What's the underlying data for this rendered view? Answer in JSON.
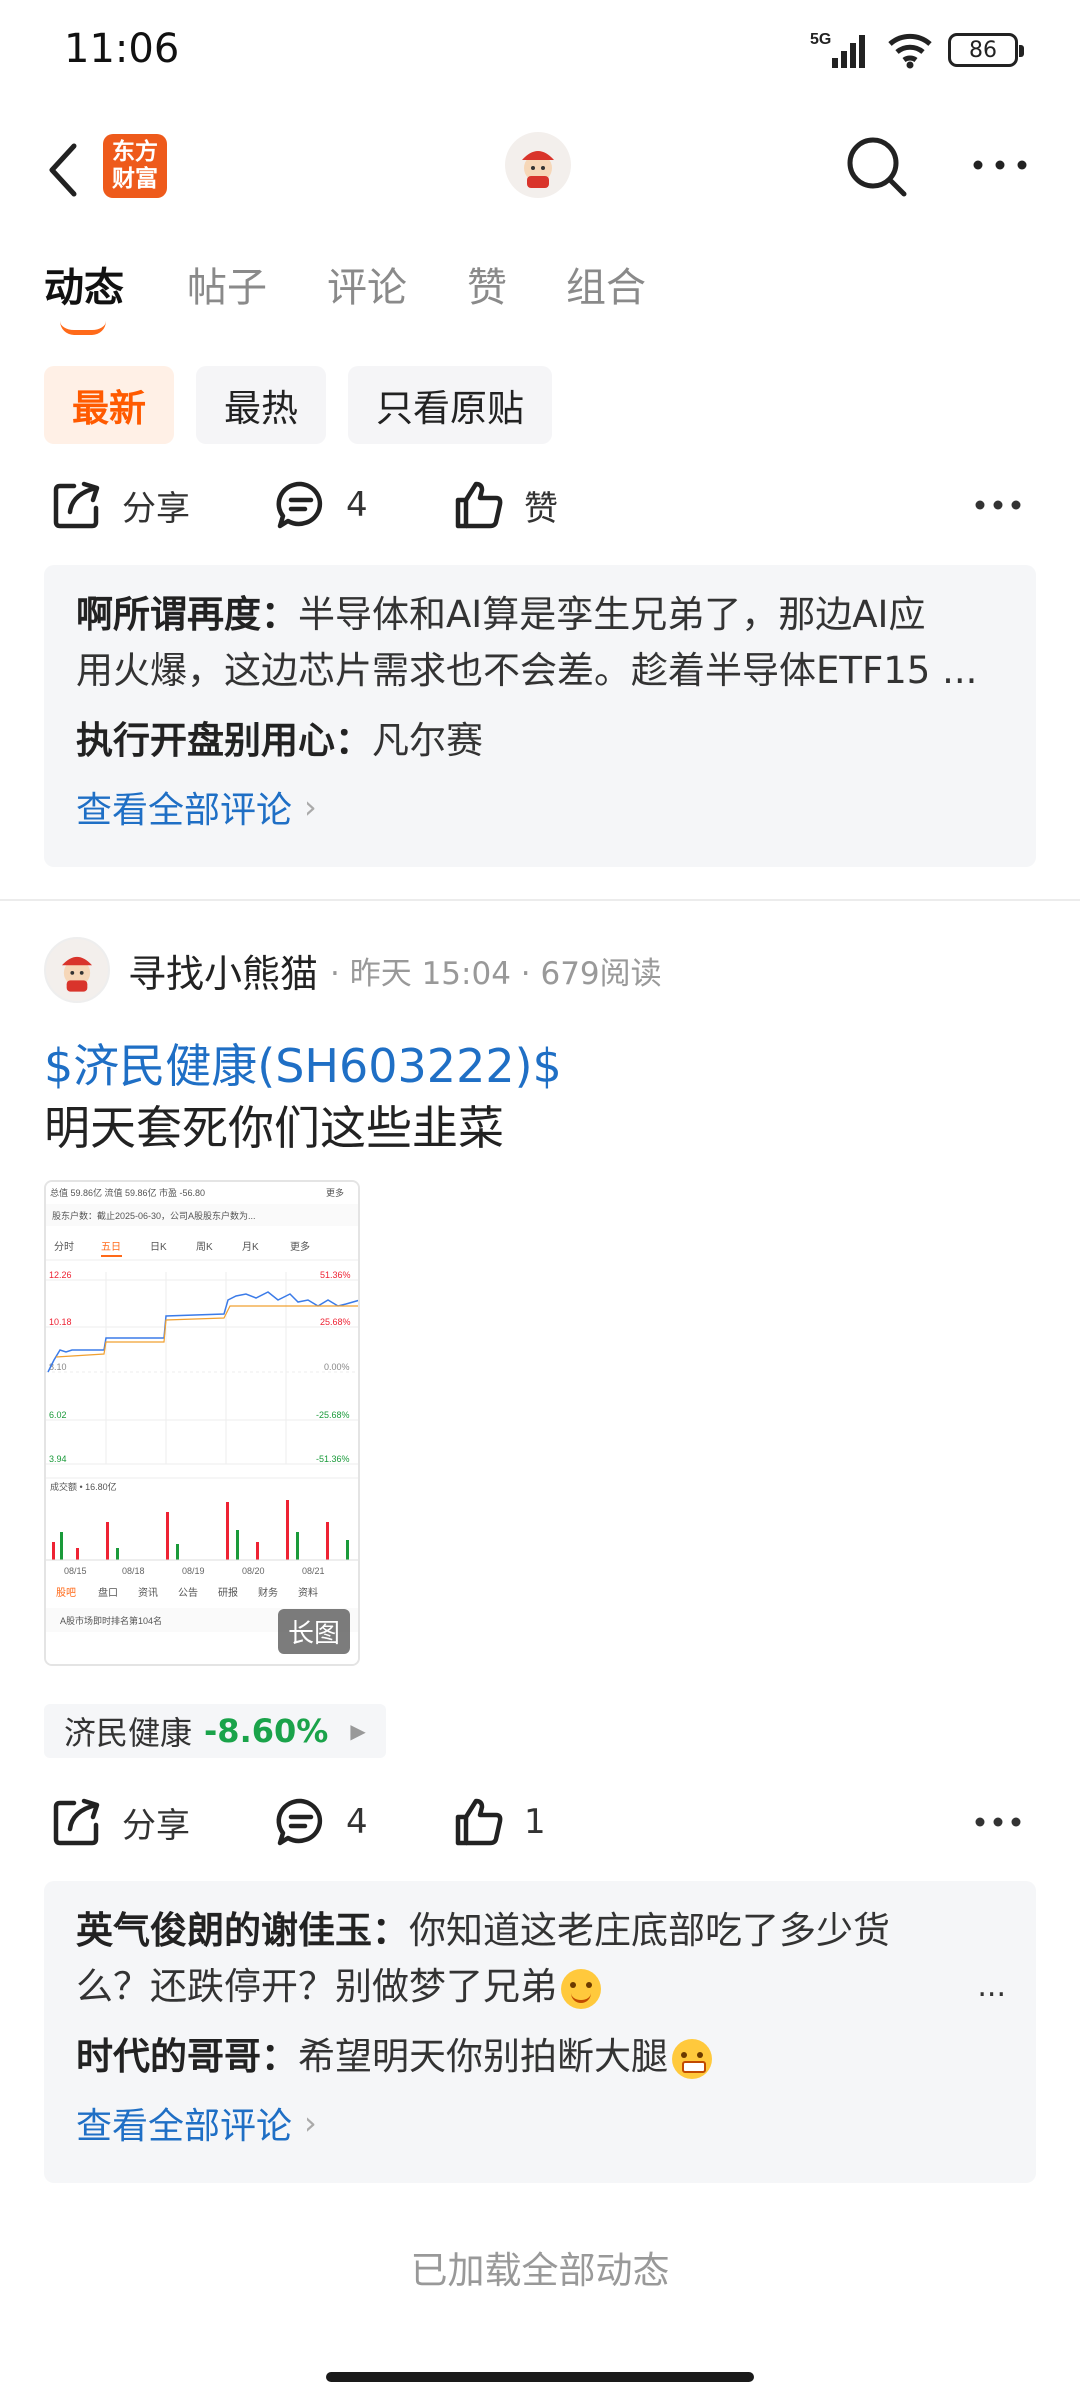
{
  "status_bar": {
    "time": "11:06",
    "network": "5G",
    "battery": "86"
  },
  "header": {
    "brand_logo_line1": "东方",
    "brand_logo_line2": "财富"
  },
  "tabs": [
    "动态",
    "帖子",
    "评论",
    "赞",
    "组合"
  ],
  "filters": [
    "最新",
    "最热",
    "只看原贴"
  ],
  "post1": {
    "actions": {
      "share": "分享",
      "comments": "4",
      "like": "赞"
    },
    "comments": [
      {
        "user": "啊所谓再度：",
        "text_line1": "半导体和AI算是孪生兄弟了，那边AI应",
        "text_line2": "用火爆，这边芯片需求也不会差。趁着半导体ETF15 ..."
      },
      {
        "user": "执行开盘别用心：",
        "text": "凡尔赛"
      }
    ],
    "view_all": "查看全部评论"
  },
  "post2": {
    "author": "寻找小熊猫",
    "meta": "· 昨天 15:04 · 679阅读",
    "stock_link": "$济民健康(SH603222)$",
    "text": "明天套死你们这些韭菜",
    "image_badge": "长图",
    "stock_tag": {
      "name": "济民健康",
      "change": "-8.60%"
    },
    "actions": {
      "share": "分享",
      "comments": "4",
      "likes": "1"
    },
    "comments": [
      {
        "user": "英气俊朗的谢佳玉：",
        "text_line1": "你知道这老庄底部吃了多少货",
        "text_line2": "么？还跌停开？别做梦了兄弟"
      },
      {
        "user": "时代的哥哥：",
        "text": "希望明天你别拍断大腿"
      }
    ],
    "view_all": "查看全部评论"
  },
  "screenshot": {
    "header_text": "总值 59.86亿  流值 59.86亿  市盈 -56.80",
    "more": "更多",
    "notice": "股东户数：截止2025-06-30，公司A股股东户数为...",
    "tabs": [
      "分时",
      "五日",
      "日K",
      "周K",
      "月K",
      "更多"
    ],
    "left_labels": [
      "12.26",
      "10.18",
      "8.10",
      "6.02",
      "3.94"
    ],
    "right_labels": [
      "51.36%",
      "25.68%",
      "0.00%",
      "-25.68%",
      "-51.36%"
    ],
    "volume": "成交额 • 16.80亿",
    "dates": [
      "08/15",
      "08/18",
      "08/19",
      "08/20",
      "08/21"
    ],
    "bottom_tabs": [
      "股吧",
      "盘口",
      "资讯",
      "公告",
      "研报",
      "财务",
      "资料"
    ],
    "rank": "A股市场即时排名第104名"
  },
  "footer": {
    "loaded": "已加载全部动态"
  }
}
